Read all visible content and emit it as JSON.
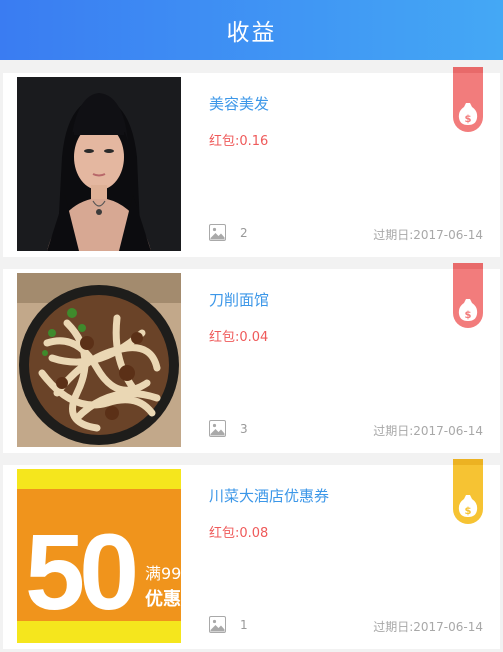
{
  "header": {
    "title": "收益"
  },
  "items": [
    {
      "name": "美容美发",
      "redpack": "红包:0.16",
      "image_count": "2",
      "expire_label": "过期日:",
      "expire_date": "2017-06-14",
      "badge_color": "#f27c7c",
      "badge_icon": "money-bag-icon"
    },
    {
      "name": "刀削面馆",
      "redpack": "红包:0.04",
      "image_count": "3",
      "expire_label": "过期日:",
      "expire_date": "2017-06-14",
      "badge_color": "#f27c7c",
      "badge_icon": "money-bag-icon"
    },
    {
      "name": "川菜大酒店优惠券",
      "redpack": "红包:0.08",
      "image_count": "1",
      "expire_label": "过期日:",
      "expire_date": "2017-06-14",
      "badge_color": "#f6c333",
      "badge_icon": "money-bag-icon",
      "thumb_text": {
        "big": "50",
        "line1": "满99",
        "line2": "优惠"
      }
    }
  ],
  "colors": {
    "header_start": "#3a7cf2",
    "header_end": "#44a8f5",
    "name": "#3c97e8",
    "redpack": "#ef5a5a",
    "background": "#f2f2f2"
  }
}
